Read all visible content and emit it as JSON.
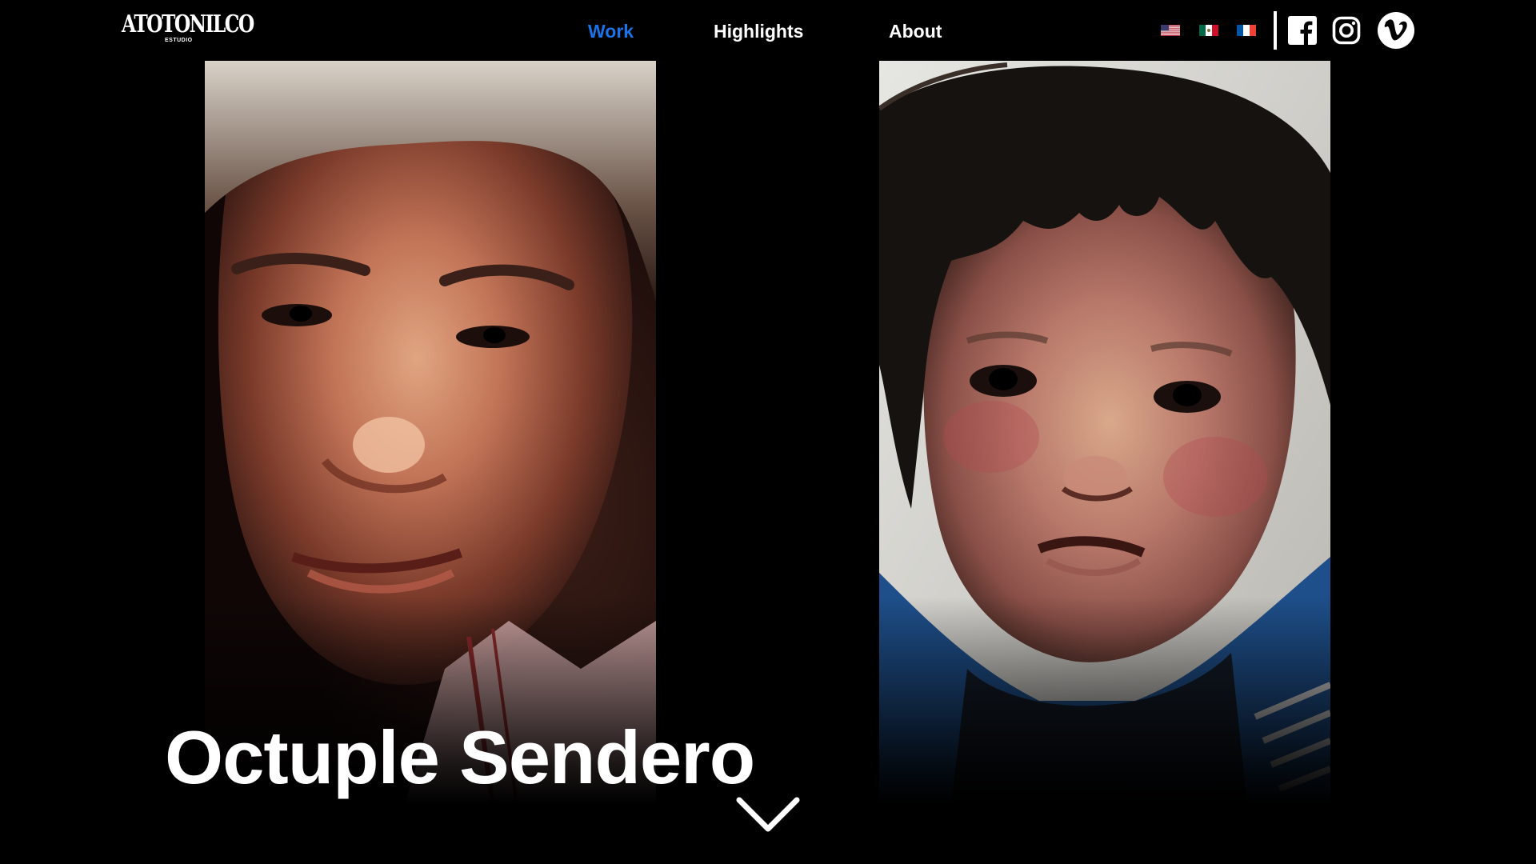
{
  "brand": {
    "logo_text": "ATOTONILCO",
    "logo_subtext": "ESTUDIO"
  },
  "nav": {
    "items": [
      {
        "label": "Work",
        "active": true
      },
      {
        "label": "Highlights",
        "active": false
      },
      {
        "label": "About",
        "active": false
      }
    ],
    "active_color": "#1a73e8",
    "text_color": "#ffffff"
  },
  "languages": [
    {
      "flag": "us-flag-icon"
    },
    {
      "flag": "mexico-flag-icon"
    },
    {
      "flag": "france-flag-icon"
    }
  ],
  "social": [
    {
      "icon": "facebook-icon"
    },
    {
      "icon": "instagram-icon"
    },
    {
      "icon": "vimeo-icon"
    }
  ],
  "hero": {
    "title": "Octuple Sendero",
    "scroll_icon": "chevron-down-icon"
  },
  "colors": {
    "background": "#000000",
    "text": "#ffffff",
    "accent": "#1a73e8"
  }
}
